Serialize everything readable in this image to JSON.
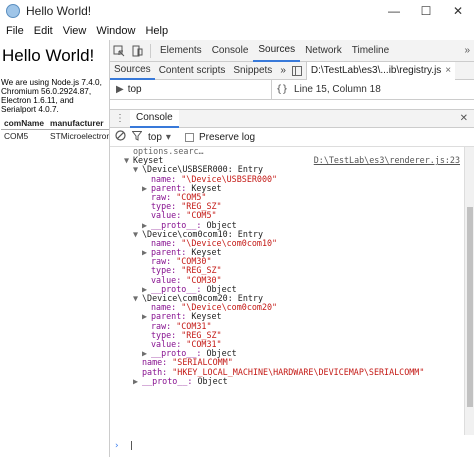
{
  "window": {
    "title": "Hello World!",
    "minimize": "—",
    "maximize": "☐",
    "close": "✕"
  },
  "menu": [
    "File",
    "Edit",
    "View",
    "Window",
    "Help"
  ],
  "page": {
    "heading": "Hello World!",
    "info": "We are using Node.js 7.4.0, Chromium 56.0.2924.87, Electron 1.6.11, and Serialport 4.0.7.",
    "table_headers": [
      "comName",
      "manufacturer"
    ],
    "table_rows": [
      [
        "COM5",
        "STMicroelectron"
      ]
    ]
  },
  "devtools": {
    "tabs": [
      "Elements",
      "Console",
      "Sources",
      "Network",
      "Timeline"
    ],
    "active_tab": "Sources",
    "more": "»",
    "src_tabs": [
      "Sources",
      "Content scripts",
      "Snippets"
    ],
    "src_more": "»",
    "file_tab": "D:\\TestLab\\es3\\...ib\\registry.js",
    "context": "top",
    "cursor_pos": "Line 15, Column 18",
    "drawer_tab": "Console",
    "console_context": "top",
    "preserve_log": "Preserve log"
  },
  "console": {
    "source_link": "D:\\TestLab\\es3\\renderer.js:23",
    "lines": [
      {
        "indent": 0,
        "tri": "",
        "parts": [
          {
            "c": "o",
            "t": "options.searc…"
          }
        ],
        "faded": true
      },
      {
        "indent": 0,
        "tri": "▼",
        "parts": [
          {
            "c": "o",
            "t": "Keyset"
          }
        ],
        "link": true
      },
      {
        "indent": 1,
        "tri": "▼",
        "parts": [
          {
            "c": "o",
            "t": "\\Device\\USBSER000: Entry"
          }
        ]
      },
      {
        "indent": 2,
        "tri": "",
        "parts": [
          {
            "c": "k",
            "t": "name: "
          },
          {
            "c": "s",
            "t": "\"\\Device\\USBSER000\""
          }
        ]
      },
      {
        "indent": 2,
        "tri": "▶",
        "parts": [
          {
            "c": "k",
            "t": "parent: "
          },
          {
            "c": "o",
            "t": "Keyset"
          }
        ]
      },
      {
        "indent": 2,
        "tri": "",
        "parts": [
          {
            "c": "k",
            "t": "raw: "
          },
          {
            "c": "s",
            "t": "\"COM5\""
          }
        ]
      },
      {
        "indent": 2,
        "tri": "",
        "parts": [
          {
            "c": "k",
            "t": "type: "
          },
          {
            "c": "s",
            "t": "\"REG_SZ\""
          }
        ]
      },
      {
        "indent": 2,
        "tri": "",
        "parts": [
          {
            "c": "k",
            "t": "value: "
          },
          {
            "c": "s",
            "t": "\"COM5\""
          }
        ]
      },
      {
        "indent": 2,
        "tri": "▶",
        "parts": [
          {
            "c": "p",
            "t": "__proto__: "
          },
          {
            "c": "o",
            "t": "Object"
          }
        ]
      },
      {
        "indent": 1,
        "tri": "▼",
        "parts": [
          {
            "c": "o",
            "t": "\\Device\\com0com10: Entry"
          }
        ]
      },
      {
        "indent": 2,
        "tri": "",
        "parts": [
          {
            "c": "k",
            "t": "name: "
          },
          {
            "c": "s",
            "t": "\"\\Device\\com0com10\""
          }
        ]
      },
      {
        "indent": 2,
        "tri": "▶",
        "parts": [
          {
            "c": "k",
            "t": "parent: "
          },
          {
            "c": "o",
            "t": "Keyset"
          }
        ]
      },
      {
        "indent": 2,
        "tri": "",
        "parts": [
          {
            "c": "k",
            "t": "raw: "
          },
          {
            "c": "s",
            "t": "\"COM30\""
          }
        ]
      },
      {
        "indent": 2,
        "tri": "",
        "parts": [
          {
            "c": "k",
            "t": "type: "
          },
          {
            "c": "s",
            "t": "\"REG_SZ\""
          }
        ]
      },
      {
        "indent": 2,
        "tri": "",
        "parts": [
          {
            "c": "k",
            "t": "value: "
          },
          {
            "c": "s",
            "t": "\"COM30\""
          }
        ]
      },
      {
        "indent": 2,
        "tri": "▶",
        "parts": [
          {
            "c": "p",
            "t": "__proto__: "
          },
          {
            "c": "o",
            "t": "Object"
          }
        ]
      },
      {
        "indent": 1,
        "tri": "▼",
        "parts": [
          {
            "c": "o",
            "t": "\\Device\\com0com20: Entry"
          }
        ]
      },
      {
        "indent": 2,
        "tri": "",
        "parts": [
          {
            "c": "k",
            "t": "name: "
          },
          {
            "c": "s",
            "t": "\"\\Device\\com0com20\""
          }
        ]
      },
      {
        "indent": 2,
        "tri": "▶",
        "parts": [
          {
            "c": "k",
            "t": "parent: "
          },
          {
            "c": "o",
            "t": "Keyset"
          }
        ]
      },
      {
        "indent": 2,
        "tri": "",
        "parts": [
          {
            "c": "k",
            "t": "raw: "
          },
          {
            "c": "s",
            "t": "\"COM31\""
          }
        ]
      },
      {
        "indent": 2,
        "tri": "",
        "parts": [
          {
            "c": "k",
            "t": "type: "
          },
          {
            "c": "s",
            "t": "\"REG_SZ\""
          }
        ]
      },
      {
        "indent": 2,
        "tri": "",
        "parts": [
          {
            "c": "k",
            "t": "value: "
          },
          {
            "c": "s",
            "t": "\"COM31\""
          }
        ]
      },
      {
        "indent": 2,
        "tri": "▶",
        "parts": [
          {
            "c": "p",
            "t": "__proto__: "
          },
          {
            "c": "o",
            "t": "Object"
          }
        ]
      },
      {
        "indent": 1,
        "tri": "",
        "parts": [
          {
            "c": "k",
            "t": "name: "
          },
          {
            "c": "s",
            "t": "\"SERIALCOMM\""
          }
        ]
      },
      {
        "indent": 1,
        "tri": "",
        "parts": [
          {
            "c": "k",
            "t": "path: "
          },
          {
            "c": "s",
            "t": "\"HKEY_LOCAL_MACHINE\\HARDWARE\\DEVICEMAP\\SERIALCOMM\""
          }
        ]
      },
      {
        "indent": 1,
        "tri": "▶",
        "parts": [
          {
            "c": "p",
            "t": "__proto__: "
          },
          {
            "c": "o",
            "t": "Object"
          }
        ]
      }
    ],
    "prompt": "›"
  }
}
